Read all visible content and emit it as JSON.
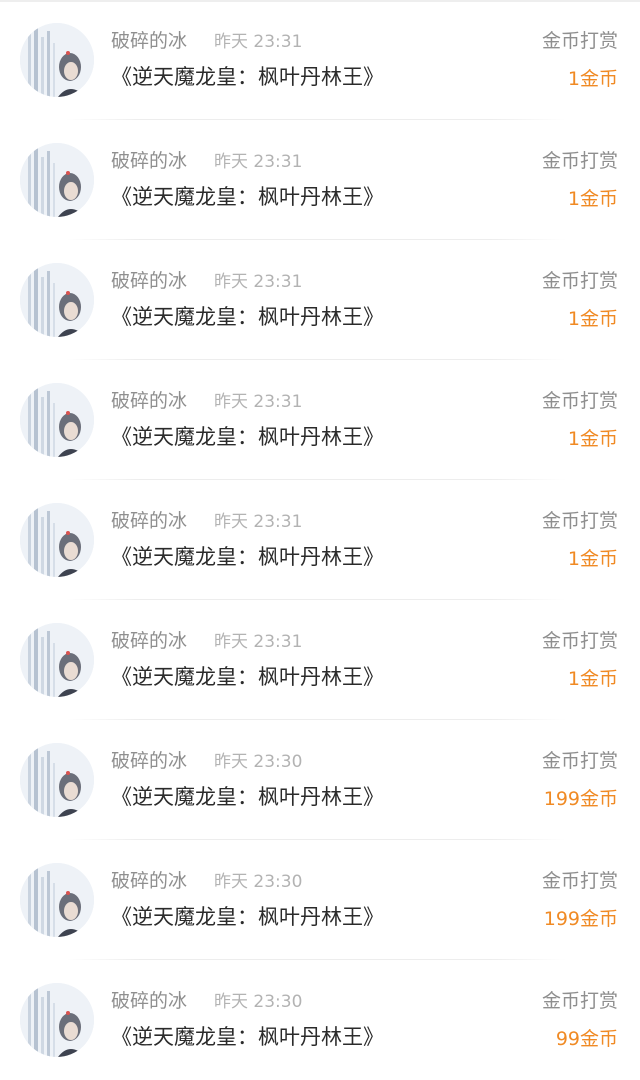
{
  "rewards": [
    {
      "user": "破碎的冰",
      "time": "昨天 23:31",
      "book": "《逆天魔龙皇：枫叶丹林王》",
      "type": "金币打赏",
      "amount": "1金币"
    },
    {
      "user": "破碎的冰",
      "time": "昨天 23:31",
      "book": "《逆天魔龙皇：枫叶丹林王》",
      "type": "金币打赏",
      "amount": "1金币"
    },
    {
      "user": "破碎的冰",
      "time": "昨天 23:31",
      "book": "《逆天魔龙皇：枫叶丹林王》",
      "type": "金币打赏",
      "amount": "1金币"
    },
    {
      "user": "破碎的冰",
      "time": "昨天 23:31",
      "book": "《逆天魔龙皇：枫叶丹林王》",
      "type": "金币打赏",
      "amount": "1金币"
    },
    {
      "user": "破碎的冰",
      "time": "昨天 23:31",
      "book": "《逆天魔龙皇：枫叶丹林王》",
      "type": "金币打赏",
      "amount": "1金币"
    },
    {
      "user": "破碎的冰",
      "time": "昨天 23:31",
      "book": "《逆天魔龙皇：枫叶丹林王》",
      "type": "金币打赏",
      "amount": "1金币"
    },
    {
      "user": "破碎的冰",
      "time": "昨天 23:30",
      "book": "《逆天魔龙皇：枫叶丹林王》",
      "type": "金币打赏",
      "amount": "199金币"
    },
    {
      "user": "破碎的冰",
      "time": "昨天 23:30",
      "book": "《逆天魔龙皇：枫叶丹林王》",
      "type": "金币打赏",
      "amount": "199金币"
    },
    {
      "user": "破碎的冰",
      "time": "昨天 23:30",
      "book": "《逆天魔龙皇：枫叶丹林王》",
      "type": "金币打赏",
      "amount": "99金币"
    }
  ],
  "colors": {
    "amount": "#f08a24",
    "secondary_text": "#8f8f8f",
    "time_text": "#b3b3b3",
    "primary_text": "#2b2b2b",
    "divider": "#ededed"
  },
  "icons": {
    "avatar": "user-avatar-icon"
  }
}
